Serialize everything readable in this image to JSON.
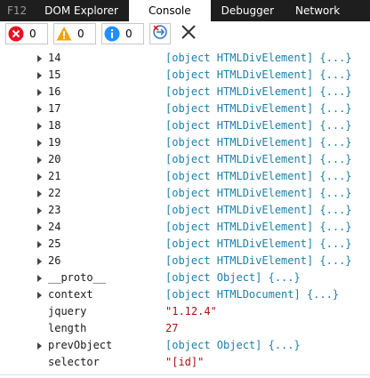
{
  "tabs": [
    {
      "label": "F12",
      "active": false
    },
    {
      "label": "DOM Explorer",
      "active": false
    },
    {
      "label": "Console",
      "active": true
    },
    {
      "label": "Debugger",
      "active": false
    },
    {
      "label": "Network",
      "active": false
    }
  ],
  "toolbar": {
    "errors_count": "0",
    "warnings_count": "0",
    "info_count": "0",
    "error_color": "#e81123",
    "warning_color": "#f0a30a",
    "info_color": "#1e90ff",
    "clear_on_navigate_icon": "clear-on-navigate-icon",
    "clear_icon": "close-x-icon"
  },
  "console": {
    "rows": [
      {
        "key": "14",
        "value": "[object HTMLDivElement] {...}",
        "kind": "obj",
        "expandable": true
      },
      {
        "key": "15",
        "value": "[object HTMLDivElement] {...}",
        "kind": "obj",
        "expandable": true
      },
      {
        "key": "16",
        "value": "[object HTMLDivElement] {...}",
        "kind": "obj",
        "expandable": true
      },
      {
        "key": "17",
        "value": "[object HTMLDivElement] {...}",
        "kind": "obj",
        "expandable": true
      },
      {
        "key": "18",
        "value": "[object HTMLDivElement] {...}",
        "kind": "obj",
        "expandable": true
      },
      {
        "key": "19",
        "value": "[object HTMLDivElement] {...}",
        "kind": "obj",
        "expandable": true
      },
      {
        "key": "20",
        "value": "[object HTMLDivElement] {...}",
        "kind": "obj",
        "expandable": true
      },
      {
        "key": "21",
        "value": "[object HTMLDivElement] {...}",
        "kind": "obj",
        "expandable": true
      },
      {
        "key": "22",
        "value": "[object HTMLDivElement] {...}",
        "kind": "obj",
        "expandable": true
      },
      {
        "key": "23",
        "value": "[object HTMLDivElement] {...}",
        "kind": "obj",
        "expandable": true
      },
      {
        "key": "24",
        "value": "[object HTMLDivElement] {...}",
        "kind": "obj",
        "expandable": true
      },
      {
        "key": "25",
        "value": "[object HTMLDivElement] {...}",
        "kind": "obj",
        "expandable": true
      },
      {
        "key": "26",
        "value": "[object HTMLDivElement] {...}",
        "kind": "obj",
        "expandable": true
      },
      {
        "key": "__proto__",
        "value": "[object Object] {...}",
        "kind": "obj",
        "expandable": true
      },
      {
        "key": "context",
        "value": "[object HTMLDocument] {...}",
        "kind": "obj",
        "expandable": true
      },
      {
        "key": "jquery",
        "value": "\"1.12.4\"",
        "kind": "str",
        "expandable": false
      },
      {
        "key": "length",
        "value": "27",
        "kind": "num",
        "expandable": false
      },
      {
        "key": "prevObject",
        "value": "[object Object] {...}",
        "kind": "obj",
        "expandable": true
      },
      {
        "key": "selector",
        "value": "\"[id]\"",
        "kind": "str",
        "expandable": false
      }
    ]
  }
}
